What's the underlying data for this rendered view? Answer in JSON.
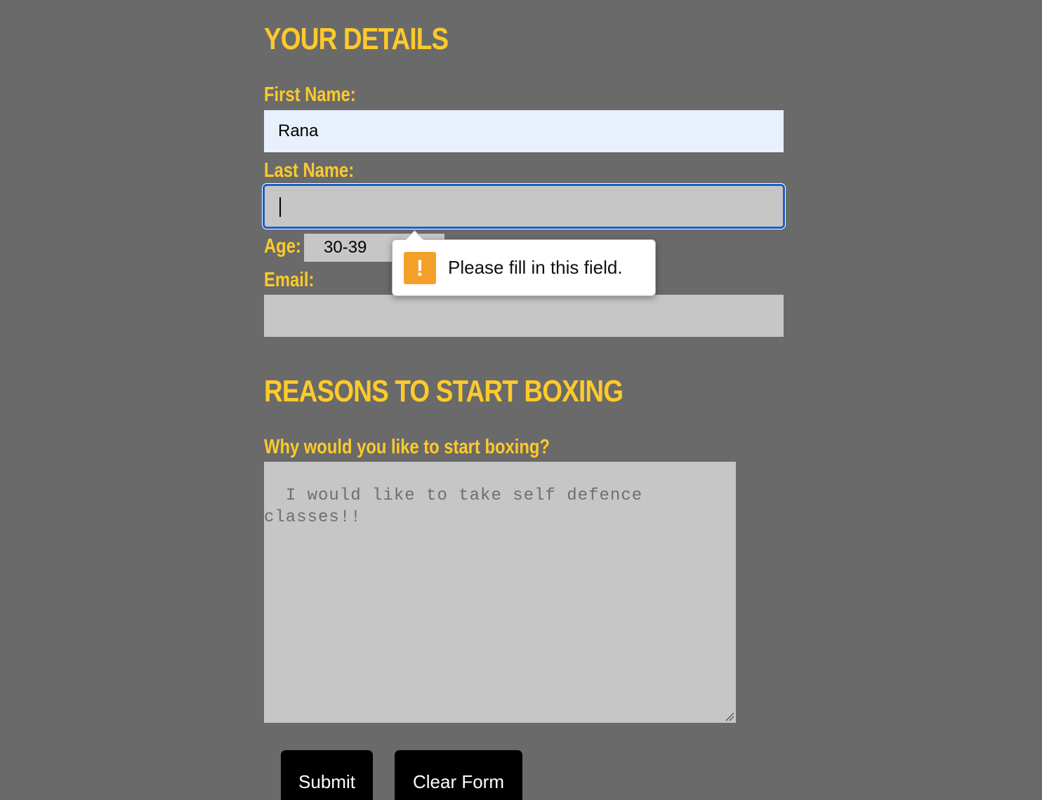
{
  "details": {
    "heading": "YOUR DETAILS",
    "first_name_label": "First Name:",
    "first_name_value": "Rana",
    "last_name_label": "Last Name:",
    "last_name_value": "",
    "age_label": "Age:",
    "age_selected": "30-39",
    "email_label": "Email:",
    "email_value": ""
  },
  "validation": {
    "message": "Please fill in this field.",
    "icon": "warning-icon",
    "icon_glyph": "!",
    "icon_color": "#f4a028"
  },
  "reasons": {
    "heading": "REASONS TO START BOXING",
    "question_label": "Why would you like to start boxing?",
    "answer_text": "I would like to take self defence classes!!"
  },
  "buttons": {
    "submit_label": "Submit",
    "clear_label": "Clear Form"
  },
  "colors": {
    "background": "#6a6a6a",
    "accent_text": "#fdca2b",
    "field_background": "#c6c6c6",
    "autofill_background": "#e8f0fe",
    "focus_ring": "#1a5fc8",
    "button_background": "#000000"
  }
}
